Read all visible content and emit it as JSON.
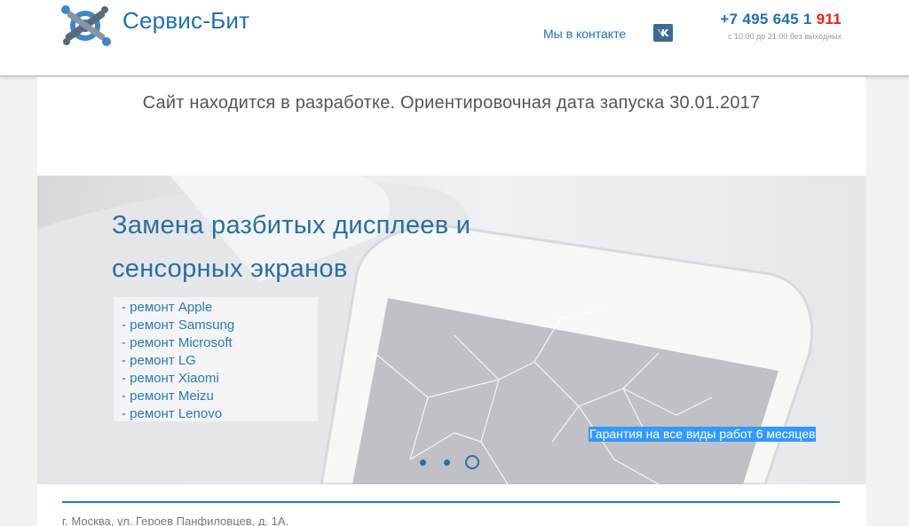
{
  "header": {
    "brand_name": "Сервис-Бит",
    "vk_link_label": "Мы в контакте",
    "vk_icon": "vk-icon",
    "phone_main": "+7 495 645 1 ",
    "phone_highlight": "911",
    "hours": "с 10:00 до 21:00 без выходных",
    "logo_icon": "gear-wrench-logo-icon"
  },
  "notice": "Сайт находится в разработке. Ориентировочная дата запуска 30.01.2017",
  "slider": {
    "title_line1": "Замена разбитых дисплеев и",
    "title_line2": "сенсорных экранов",
    "services": [
      "- ремонт Apple",
      "- ремонт Samsung",
      "- ремонт Microsoft",
      "- ремонт LG",
      "- ремонт Xiaomi",
      "- ремонт Meizu",
      "- ремонт Lenovo"
    ],
    "warranty": "Гарантия на все виды работ 6 месяцев",
    "dots_count": 3,
    "active_dot": 3
  },
  "footer": {
    "address": "г. Москва, ул. Героев Панфиловцев, д. 1А."
  },
  "colors": {
    "brand_blue": "#1f6fb2",
    "slide_blue": "#2a6f9f",
    "phone_red": "#e2231a",
    "highlight": "#3399ff"
  }
}
